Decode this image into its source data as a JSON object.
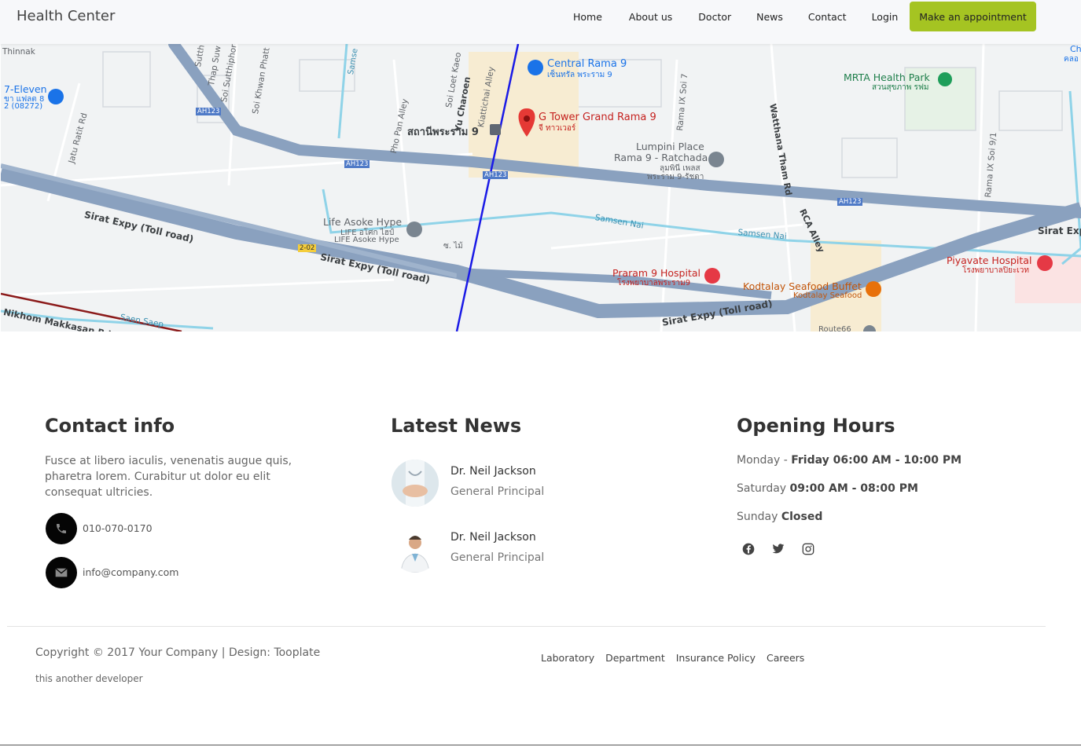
{
  "nav": {
    "brand": "Health Center",
    "links": [
      "Home",
      "About us",
      "Doctor",
      "News",
      "Contact",
      "Login"
    ],
    "cta": "Make an appointment"
  },
  "map": {
    "labels": {
      "central_rama9": "Central Rama 9",
      "central_rama9_th": "เซ็นทรัล พระราม 9",
      "g_tower": "G Tower Grand Rama 9",
      "g_tower_th": "จี ทาวเวอร์",
      "mrta_park": "MRTA Health Park",
      "mrta_park_th": "สวนสุขภาพ รฟม",
      "seven_eleven": "7-Eleven",
      "seven_eleven_sub": "ขา แฟลต 8",
      "seven_eleven_sub2": "2 (08272)",
      "lumpini": "Lumpini Place",
      "lumpini2": "Rama 9 - Ratchada",
      "lumpini_th": "ลุมพินี เพลส",
      "lumpini_th2": "พระราม 9-รัชดา",
      "station": "สถานีพระราม 9",
      "life_asoke": "Life Asoke Hype",
      "life_asoke_th": "LIFE อโศก ไฮป์",
      "life_asoke2": "LIFE Asoke Hype",
      "praram": "Praram 9 Hospital",
      "praram_th": "โรงพยาบาลพระราม9",
      "kodtalay": "Kodtalay Seafood Buffet",
      "kodtalay2": "Kodtalay Seafood",
      "piyavate": "Piyavate Hospital",
      "piyavate_th": "โรงพยาบาลปิยะเวท",
      "sirat1": "Sirat Expy (Toll road)",
      "sirat2": "Sirat Expy (Toll road)",
      "sirat3": "Sirat Expy (Toll road)",
      "sirat4": "Sirat Exp",
      "samsen1": "Samsen Nai",
      "samsen2": "Samsen Nai",
      "saen_saep": "Saen Saep",
      "nikhom": "Nikhom Makkasan Rd",
      "wattana": "Watthana Tham Rd",
      "rca": "RCA Alley",
      "rama9_7": "Rama IX Soi 7",
      "rama9_9": "Rama IX Soi 9/1",
      "yu_charoen": "Yu Charoen",
      "kiattichai": "Kiattichai Alley",
      "soi_loet": "Soi Loet Kaeo",
      "pho_pan": "Pho Pan Alley",
      "soi_khwan": "Soi Khwan Phatt",
      "jatu": "Jatu Ratit Rd",
      "samse": "Samse",
      "thap": "Thap Suw",
      "suthi": "Soi Sutthiphor",
      "sutth": "Sutth",
      "thinnak": "Thinnak",
      "ah1": "AH123",
      "ah2": "AH123",
      "ah3": "AH123",
      "ah4": "AH123",
      "exit": "2-02",
      "mai": "ซ. ไม้",
      "route": "Route66",
      "ch": "Ch",
      "khlo": "คลอ"
    }
  },
  "contact": {
    "title": "Contact info",
    "text": "Fusce at libero iaculis, venenatis augue quis, pharetra lorem. Curabitur ut dolor eu elit consequat ultricies.",
    "phone": "010-070-0170",
    "email": "info@company.com"
  },
  "news": {
    "title": "Latest News",
    "items": [
      {
        "name": "Dr. Neil Jackson",
        "role": "General Principal"
      },
      {
        "name": "Dr. Neil Jackson",
        "role": "General Principal"
      }
    ]
  },
  "hours": {
    "title": "Opening Hours",
    "rows": [
      {
        "day": "Monday - ",
        "time": "Friday 06:00 AM - 10:00 PM"
      },
      {
        "day": "Saturday ",
        "time": "09:00 AM - 08:00 PM"
      },
      {
        "day": "Sunday ",
        "time": "Closed"
      }
    ],
    "social": [
      "facebook-icon",
      "twitter-icon",
      "instagram-icon"
    ]
  },
  "footer": {
    "copyright": "Copyright © 2017 Your Company | Design: Tooplate",
    "developer": "this another developer",
    "links": [
      "Laboratory",
      "Department",
      "Insurance Policy",
      "Careers"
    ]
  },
  "colors": {
    "accent": "#a5c422",
    "map_bg": "#f1f3f4",
    "highway": "#8aa1bf",
    "water": "#8fd3e8",
    "metro": "#1a1ae6"
  }
}
